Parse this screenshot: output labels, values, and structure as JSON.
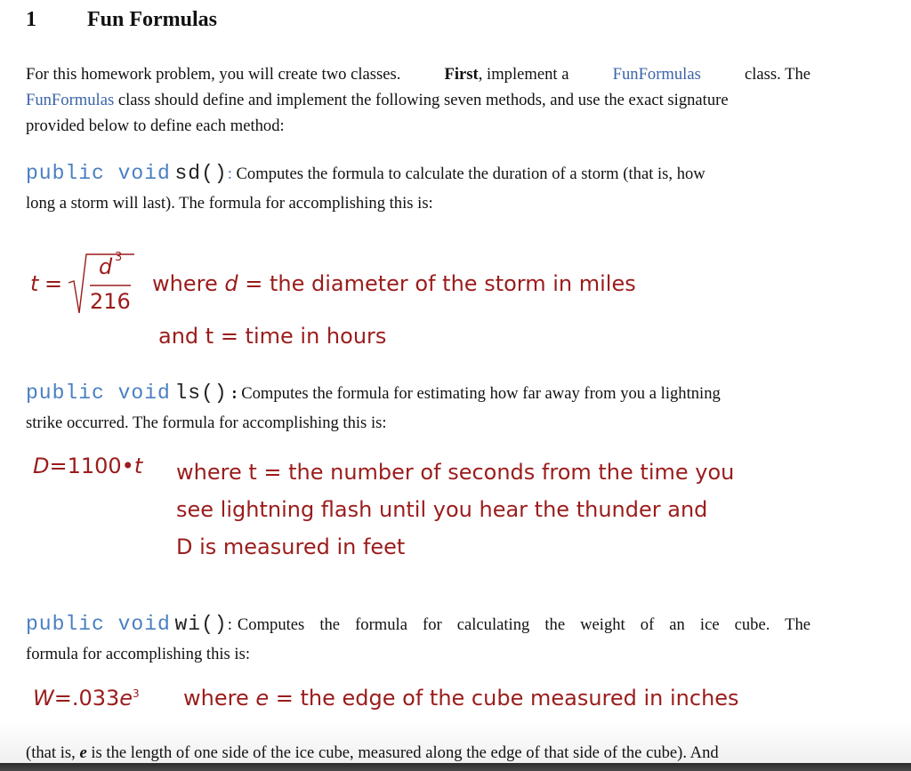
{
  "section": {
    "number": "1",
    "title": "Fun Formulas"
  },
  "intro": {
    "line1_a": "For this homework problem, you will create two classes.",
    "line1_bold": "First",
    "line1_b": ", implement a",
    "line1_link": "FunFormulas",
    "line1_c": "class. The",
    "line2_link": "FunFormulas",
    "line2_rest": "class should define and implement the following seven methods, and use the exact signature",
    "line3": "provided below to define each method:"
  },
  "methods": [
    {
      "keywords": "public void",
      "name": "sd()",
      "colon": ":",
      "desc_line1": "Computes the formula to calculate the duration of a storm (that is, how",
      "desc_line2": "long a storm will last). The formula for accomplishing this is:",
      "formula": {
        "lhs": "t",
        "equals": "=",
        "numerator_base": "d",
        "numerator_exp": "3",
        "denominator": "216",
        "where_prefix": "where",
        "where_var": "d",
        "where_rest": "= the diameter of the storm in miles",
        "line2": "and t = time in hours"
      }
    },
    {
      "keywords": "public void",
      "name": "ls()",
      "colon": ":",
      "desc_line1": "Computes the formula for estimating how far away from you a lightning",
      "desc_line2": "strike occurred. The formula for accomplishing this is:",
      "formula": {
        "lhs": "D",
        "equals": "=",
        "constant": "1100",
        "operator": "•",
        "var": "t",
        "line1": "where t = the number of seconds from the time you",
        "line2": "see lightning flash until you hear the thunder and",
        "line3": "D is measured in feet"
      }
    },
    {
      "keywords": "public void",
      "name": "wi()",
      "colon": ":",
      "desc_line1": "Computes the formula for calculating the weight of an ice cube. The",
      "desc_line2": "formula for accomplishing this is:",
      "formula": {
        "lhs": "W",
        "equals": "=",
        "constant": ".033",
        "var": "e",
        "exp": "3",
        "where_prefix": "where",
        "where_var": "e",
        "where_rest": "= the edge of the cube measured in inches"
      },
      "after_a": "(that is,",
      "after_var": "e",
      "after_b": "is the length of one side of the ice cube, measured along the edge of that side of the cube). And"
    }
  ],
  "colors": {
    "link": "#3b63a8",
    "code_keyword": "#4a7fc2",
    "formula": "#9b1c1c",
    "body_text": "#111111"
  }
}
